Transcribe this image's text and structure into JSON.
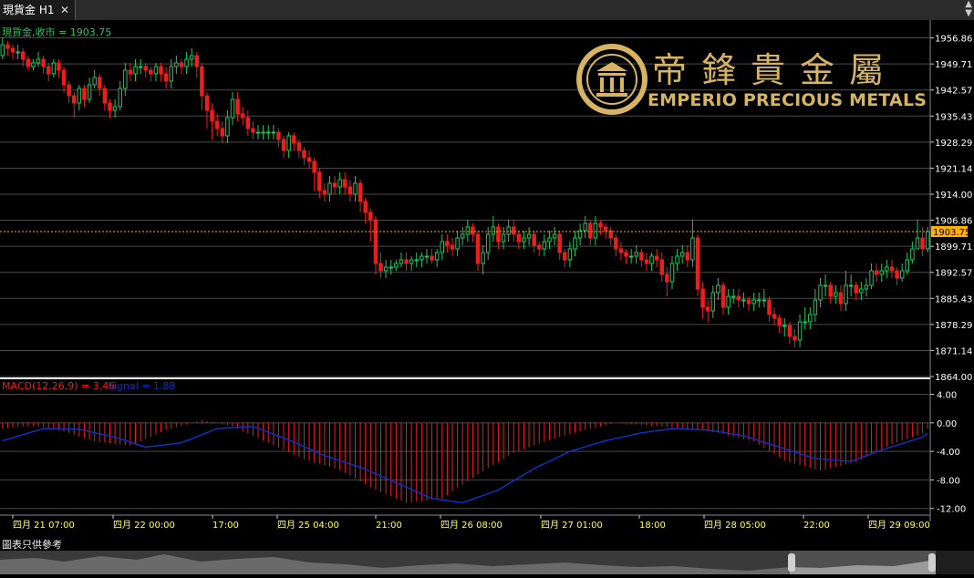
{
  "tab": {
    "title": "現貨金 H1",
    "close_glyph": "✕",
    "menu_glyph_top": "▲",
    "menu_glyph_bottom": "▼"
  },
  "logo": {
    "chinese": "帝鋒貴金屬",
    "english": "EMPERIO PRECIOUS METALS"
  },
  "footnote": "圖表只供參考",
  "colors": {
    "up": "#22c55e",
    "down": "#ef1c1c",
    "grid": "#4a4a4a",
    "price_line": "#ffb000",
    "signal": "#1030c0",
    "axis_text": "#ffffff",
    "time_text": "#ffff66"
  },
  "chart_data": [
    {
      "type": "candlestick",
      "title": "現貨金 H1",
      "info_label": "現貨金,收市 = 1903.75",
      "last_price": 1903.75,
      "last_price_label": "1903.75",
      "ylim": [
        1864.0,
        1960.0
      ],
      "y_ticks": [
        "1956.86",
        "1949.71",
        "1942.57",
        "1935.43",
        "1928.29",
        "1921.14",
        "1914.00",
        "1906.86",
        "1899.71",
        "1892.57",
        "1885.43",
        "1878.29",
        "1871.14",
        "1864.00"
      ],
      "x_tick_labels": [
        "四月 21 07:00",
        "四月 22 00:00",
        "17:00",
        "四月 25 04:00",
        "21:00",
        "四月 26 08:00",
        "四月 27 01:00",
        "18:00",
        "四月 28 05:00",
        "22:00",
        "四月 29 09:00"
      ],
      "closes": [
        1955,
        1954,
        1953,
        1953,
        1951,
        1949,
        1950,
        1951,
        1949,
        1947,
        1950,
        1948,
        1944,
        1941,
        1939,
        1943,
        1940,
        1944,
        1946,
        1943,
        1939,
        1937,
        1938,
        1943,
        1948,
        1947,
        1949,
        1949,
        1948,
        1947,
        1949,
        1947,
        1945,
        1949,
        1950,
        1949,
        1951,
        1952,
        1949,
        1941,
        1937,
        1934,
        1932,
        1930,
        1935,
        1940,
        1936,
        1935,
        1932,
        1931,
        1931,
        1931,
        1931,
        1931,
        1929,
        1926,
        1930,
        1928,
        1926,
        1924,
        1923,
        1920,
        1915,
        1914,
        1917,
        1916,
        1918,
        1916,
        1914,
        1917,
        1912,
        1909,
        1907,
        1895,
        1893,
        1894,
        1894,
        1895,
        1896,
        1895,
        1896,
        1896,
        1897,
        1897,
        1896,
        1898,
        1901,
        1900,
        1899,
        1902,
        1903,
        1905,
        1903,
        1895,
        1898,
        1903,
        1905,
        1901,
        1903,
        1905,
        1903,
        1901,
        1902,
        1903,
        1900,
        1899,
        1901,
        1902,
        1903,
        1898,
        1896,
        1899,
        1902,
        1904,
        1906,
        1902,
        1906,
        1905,
        1904,
        1902,
        1899,
        1898,
        1897,
        1897,
        1898,
        1896,
        1895,
        1897,
        1896,
        1892,
        1890,
        1895,
        1897,
        1898,
        1896,
        1902,
        1888,
        1883,
        1882,
        1887,
        1889,
        1883,
        1886,
        1886,
        1885,
        1885,
        1884,
        1885,
        1885,
        1885,
        1881,
        1880,
        1878,
        1878,
        1875,
        1874,
        1879,
        1879,
        1881,
        1885,
        1889,
        1889,
        1886,
        1887,
        1884,
        1889,
        1889,
        1887,
        1888,
        1889,
        1893,
        1892,
        1893,
        1894,
        1893,
        1891,
        1893,
        1896,
        1899,
        1902,
        1899,
        1903.75
      ],
      "opens": [
        1952,
        1955,
        1954,
        1953,
        1953,
        1951,
        1949,
        1950,
        1951,
        1949,
        1947,
        1950,
        1948,
        1944,
        1941,
        1939,
        1943,
        1940,
        1944,
        1946,
        1943,
        1939,
        1937,
        1938,
        1943,
        1948,
        1947,
        1949,
        1949,
        1948,
        1947,
        1949,
        1947,
        1945,
        1949,
        1950,
        1949,
        1951,
        1952,
        1949,
        1941,
        1937,
        1934,
        1932,
        1930,
        1935,
        1940,
        1936,
        1935,
        1932,
        1931,
        1931,
        1931,
        1931,
        1931,
        1929,
        1926,
        1930,
        1928,
        1926,
        1924,
        1923,
        1920,
        1915,
        1914,
        1917,
        1916,
        1918,
        1916,
        1914,
        1917,
        1912,
        1909,
        1907,
        1895,
        1893,
        1894,
        1894,
        1895,
        1896,
        1895,
        1896,
        1896,
        1897,
        1897,
        1896,
        1898,
        1901,
        1900,
        1899,
        1902,
        1903,
        1905,
        1903,
        1895,
        1898,
        1903,
        1905,
        1901,
        1903,
        1905,
        1903,
        1901,
        1902,
        1903,
        1900,
        1899,
        1901,
        1902,
        1903,
        1898,
        1896,
        1899,
        1902,
        1904,
        1906,
        1902,
        1906,
        1905,
        1904,
        1902,
        1899,
        1898,
        1897,
        1897,
        1898,
        1896,
        1895,
        1897,
        1896,
        1892,
        1890,
        1895,
        1897,
        1898,
        1896,
        1902,
        1888,
        1883,
        1882,
        1887,
        1889,
        1883,
        1886,
        1886,
        1885,
        1885,
        1884,
        1885,
        1885,
        1885,
        1881,
        1880,
        1878,
        1878,
        1875,
        1874,
        1879,
        1879,
        1881,
        1885,
        1889,
        1889,
        1886,
        1887,
        1884,
        1889,
        1889,
        1887,
        1888,
        1889,
        1893,
        1892,
        1893,
        1894,
        1893,
        1891,
        1893,
        1896,
        1899,
        1902,
        1899
      ],
      "highs": [
        1957,
        1956,
        1955,
        1955,
        1954,
        1952,
        1951,
        1953,
        1952,
        1950,
        1951,
        1951,
        1949,
        1945,
        1942,
        1944,
        1944,
        1946,
        1948,
        1947,
        1944,
        1940,
        1940,
        1945,
        1950,
        1950,
        1951,
        1951,
        1950,
        1949,
        1950,
        1950,
        1949,
        1951,
        1952,
        1951,
        1953,
        1954,
        1953,
        1950,
        1942,
        1939,
        1936,
        1934,
        1937,
        1942,
        1942,
        1938,
        1937,
        1934,
        1933,
        1933,
        1933,
        1933,
        1932,
        1930,
        1931,
        1931,
        1929,
        1927,
        1926,
        1924,
        1921,
        1917,
        1919,
        1919,
        1920,
        1920,
        1918,
        1919,
        1918,
        1913,
        1910,
        1908,
        1898,
        1896,
        1896,
        1896,
        1898,
        1898,
        1897,
        1898,
        1898,
        1899,
        1899,
        1899,
        1903,
        1903,
        1902,
        1904,
        1905,
        1907,
        1906,
        1904,
        1900,
        1905,
        1908,
        1906,
        1905,
        1907,
        1907,
        1904,
        1904,
        1905,
        1904,
        1901,
        1903,
        1904,
        1905,
        1904,
        1899,
        1901,
        1904,
        1906,
        1908,
        1907,
        1908,
        1907,
        1906,
        1905,
        1903,
        1901,
        1899,
        1899,
        1900,
        1899,
        1898,
        1898,
        1899,
        1898,
        1894,
        1897,
        1899,
        1900,
        1900,
        1907,
        1903,
        1890,
        1885,
        1889,
        1891,
        1890,
        1888,
        1888,
        1888,
        1887,
        1886,
        1887,
        1887,
        1888,
        1886,
        1883,
        1881,
        1880,
        1879,
        1877,
        1881,
        1883,
        1883,
        1888,
        1891,
        1892,
        1890,
        1889,
        1889,
        1893,
        1892,
        1890,
        1890,
        1891,
        1895,
        1895,
        1895,
        1896,
        1896,
        1894,
        1895,
        1898,
        1901,
        1907,
        1905,
        1905
      ],
      "lows": [
        1951,
        1952,
        1951,
        1951,
        1949,
        1948,
        1948,
        1949,
        1947,
        1945,
        1946,
        1946,
        1942,
        1939,
        1935,
        1937,
        1938,
        1939,
        1943,
        1941,
        1937,
        1935,
        1935,
        1937,
        1941,
        1945,
        1945,
        1947,
        1946,
        1945,
        1945,
        1945,
        1943,
        1943,
        1947,
        1947,
        1947,
        1949,
        1946,
        1937,
        1932,
        1929,
        1930,
        1928,
        1928,
        1933,
        1934,
        1933,
        1930,
        1929,
        1929,
        1929,
        1929,
        1929,
        1927,
        1924,
        1924,
        1926,
        1924,
        1922,
        1921,
        1915,
        1913,
        1912,
        1912,
        1914,
        1914,
        1914,
        1912,
        1912,
        1909,
        1906,
        1901,
        1892,
        1891,
        1891,
        1892,
        1893,
        1894,
        1893,
        1893,
        1894,
        1894,
        1895,
        1895,
        1894,
        1896,
        1898,
        1897,
        1897,
        1900,
        1901,
        1901,
        1893,
        1892,
        1896,
        1901,
        1899,
        1899,
        1901,
        1901,
        1899,
        1899,
        1900,
        1898,
        1897,
        1897,
        1899,
        1900,
        1896,
        1894,
        1894,
        1897,
        1900,
        1902,
        1900,
        1900,
        1903,
        1902,
        1900,
        1897,
        1896,
        1895,
        1895,
        1895,
        1894,
        1893,
        1893,
        1894,
        1890,
        1886,
        1888,
        1893,
        1895,
        1894,
        1894,
        1886,
        1880,
        1879,
        1880,
        1885,
        1881,
        1881,
        1884,
        1883,
        1883,
        1882,
        1882,
        1883,
        1883,
        1879,
        1878,
        1876,
        1875,
        1873,
        1872,
        1872,
        1877,
        1877,
        1879,
        1883,
        1886,
        1884,
        1884,
        1882,
        1882,
        1886,
        1885,
        1885,
        1886,
        1888,
        1890,
        1890,
        1891,
        1891,
        1889,
        1890,
        1892,
        1895,
        1899,
        1897,
        1898
      ]
    },
    {
      "type": "bar+line",
      "title": "MACD(12,26,9) = 3.46",
      "macd_label": "MACD(12,26,9) = 3.46",
      "signal_label": "Signal = 1.88",
      "macd_value": 3.46,
      "signal_value": 1.88,
      "ylim": [
        -12.8,
        5.6
      ],
      "y_ticks": [
        "4.00",
        "0.00",
        "-4.00",
        "-8.00",
        "-12.00"
      ],
      "macd_anchors_x": [
        0,
        6,
        12,
        18,
        25,
        32,
        39,
        45,
        52,
        59,
        66,
        73,
        79,
        86,
        93,
        100,
        107,
        114,
        120,
        127,
        134,
        140,
        147,
        153,
        160,
        167,
        174,
        180,
        187
      ],
      "macd_anchors_y": [
        -0.8,
        -0.4,
        -1.2,
        -2.6,
        -3.2,
        -1.0,
        0.4,
        -0.5,
        -2.8,
        -5.1,
        -6.6,
        -9.4,
        -11.2,
        -10.6,
        -7.2,
        -4.2,
        -2.4,
        -1.0,
        0.0,
        -0.4,
        -0.8,
        -1.4,
        -2.6,
        -5.3,
        -6.7,
        -5.5,
        -3.0,
        -1.5,
        3.46
      ],
      "signal_anchors_x": [
        0,
        8,
        15,
        22,
        28,
        35,
        42,
        49,
        56,
        63,
        70,
        77,
        84,
        90,
        97,
        104,
        111,
        118,
        125,
        131,
        138,
        145,
        152,
        159,
        166,
        172,
        180,
        187
      ],
      "signal_anchors_y": [
        -2.5,
        -0.8,
        -0.9,
        -2.0,
        -3.4,
        -2.8,
        -0.8,
        -0.5,
        -2.4,
        -4.6,
        -6.2,
        -8.4,
        -10.6,
        -11.2,
        -9.4,
        -6.4,
        -4.0,
        -2.5,
        -1.4,
        -0.8,
        -1.0,
        -1.8,
        -3.4,
        -5.0,
        -5.4,
        -3.8,
        -2.0,
        1.88
      ]
    }
  ]
}
